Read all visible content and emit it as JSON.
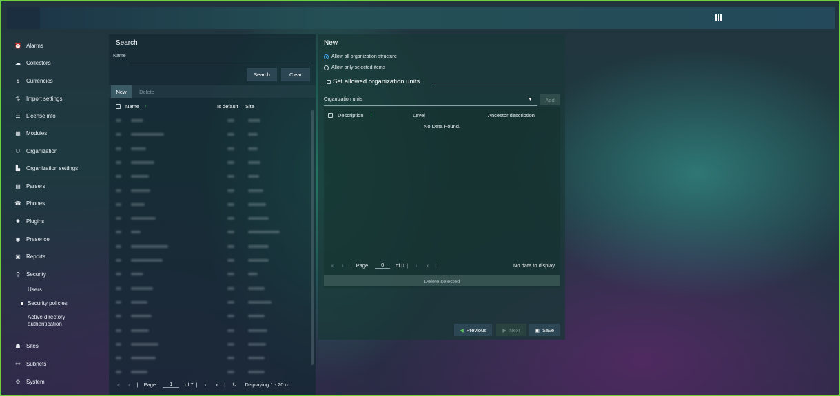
{
  "sidebar": {
    "items": [
      {
        "label": "Alarms",
        "icon": "alarm-clock-icon"
      },
      {
        "label": "Collectors",
        "icon": "cloud-icon"
      },
      {
        "label": "Currencies",
        "icon": "dollar-icon"
      },
      {
        "label": "Import settings",
        "icon": "import-icon"
      },
      {
        "label": "License info",
        "icon": "list-icon"
      },
      {
        "label": "Modules",
        "icon": "modules-icon"
      },
      {
        "label": "Organization",
        "icon": "organization-icon"
      },
      {
        "label": "Organization settings",
        "icon": "org-settings-icon"
      },
      {
        "label": "Parsers",
        "icon": "parsers-icon"
      },
      {
        "label": "Phones",
        "icon": "phone-icon"
      },
      {
        "label": "Plugins",
        "icon": "puzzle-icon"
      },
      {
        "label": "Presence",
        "icon": "presence-icon"
      },
      {
        "label": "Reports",
        "icon": "report-icon"
      },
      {
        "label": "Security",
        "icon": "user-icon"
      }
    ],
    "security_sub": [
      "Users",
      "Security policies",
      "Active directory authentication"
    ],
    "bottom_items": [
      {
        "label": "Sites",
        "icon": "sites-icon"
      },
      {
        "label": "Subnets",
        "icon": "subnets-icon"
      },
      {
        "label": "System",
        "icon": "gear-icon"
      }
    ]
  },
  "search": {
    "title": "Search",
    "name_label": "Name",
    "search_button": "Search",
    "clear_button": "Clear",
    "new_tab": "New",
    "delete_tab": "Delete",
    "columns": {
      "name": "Name",
      "sort": "↑",
      "is_default": "Is default",
      "site": "Site"
    },
    "pager": {
      "page_label": "Page",
      "page_value": "1",
      "of_label": "of 7",
      "displaying": "Displaying 1 - 20 o"
    }
  },
  "new_panel": {
    "title": "New",
    "option_all": "Allow all organization structure",
    "option_selected": "Allow only selected items",
    "section_title": "Set allowed organization units",
    "org_units_label": "Organization units",
    "add_button": "Add",
    "columns": {
      "description": "Description",
      "sort": "↑",
      "level": "Level",
      "ancestor": "Ancestor description"
    },
    "empty": "No Data Found.",
    "pager": {
      "page_label": "Page",
      "page_value": "0",
      "of_label": "of 0",
      "status": "No data to display"
    },
    "delete_selected": "Delete selected",
    "previous_button": "Previous",
    "next_button": "Next",
    "save_button": "Save"
  },
  "colors": {
    "accent_green": "#6fcf3f",
    "radio_blue": "#3fa9f5"
  }
}
